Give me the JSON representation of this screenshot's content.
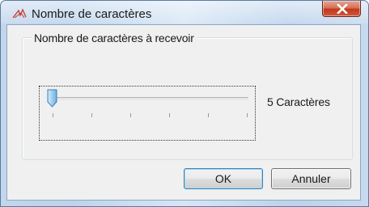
{
  "window": {
    "title": "Nombre de caractères",
    "app_icon": "scribble-icon",
    "close_icon": "close-x-icon"
  },
  "group": {
    "label": "Nombre de caractères à recevoir"
  },
  "slider": {
    "value_label": "5 Caractères",
    "position_fraction": 0,
    "tick_count": 6
  },
  "buttons": {
    "ok_label": "OK",
    "cancel_label": "Annuler"
  },
  "colors": {
    "close_button": "#c7391c",
    "default_button_border": "#3c7fb1",
    "slider_thumb": "#4a9ad6"
  }
}
